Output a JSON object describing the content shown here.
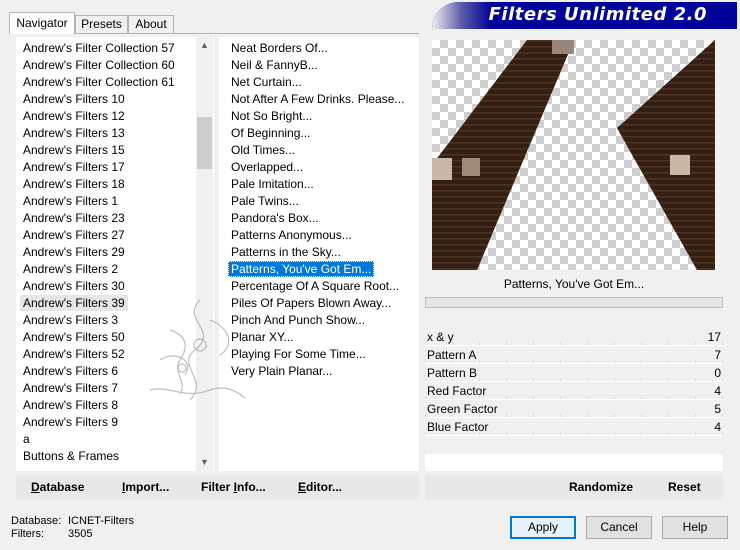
{
  "tabs": [
    {
      "label": "Navigator",
      "active": true
    },
    {
      "label": "Presets",
      "active": false
    },
    {
      "label": "About",
      "active": false
    }
  ],
  "banner": {
    "title": "Filters Unlimited 2.0"
  },
  "categories": [
    "Andrew's Filter Collection 57",
    "Andrew's Filter Collection 60",
    "Andrew's Filter Collection 61",
    "Andrew's Filters 10",
    "Andrew's Filters 12",
    "Andrew's Filters 13",
    "Andrew's Filters 15",
    "Andrew's Filters 17",
    "Andrew's Filters 18",
    "Andrew's Filters 1",
    "Andrew's Filters 23",
    "Andrew's Filters 27",
    "Andrew's Filters 29",
    "Andrew's Filters 2",
    "Andrew's Filters 30",
    "Andrew's Filters 39",
    "Andrew's Filters 3",
    "Andrew's Filters 50",
    "Andrew's Filters 52",
    "Andrew's Filters 6",
    "Andrew's Filters 7",
    "Andrew's Filters 8",
    "Andrew's Filters 9",
    "a",
    "Buttons & Frames"
  ],
  "selected_category": "Andrew's Filters 39",
  "filters": [
    "Neat Borders Of...",
    "Neil & FannyB...",
    "Net Curtain...",
    "Not After A Few Drinks. Please...",
    "Not So Bright...",
    "Of Beginning...",
    "Old Times...",
    "Overlapped...",
    "Pale Imitation...",
    "Pale Twins...",
    "Pandora's Box...",
    "Patterns Anonymous...",
    "Patterns in the Sky...",
    "Patterns, You've Got Em...",
    "Percentage Of A Square Root...",
    "Piles Of Papers Blown Away...",
    "Pinch And Punch Show...",
    "Planar XY...",
    "Playing For Some Time...",
    "Very Plain Planar..."
  ],
  "selected_filter": "Patterns, You've Got Em...",
  "preview": {
    "filter_name": "Patterns, You've Got Em..."
  },
  "parameters": [
    {
      "name": "x & y",
      "value": "17"
    },
    {
      "name": "Pattern A",
      "value": "7"
    },
    {
      "name": "Pattern B",
      "value": "0"
    },
    {
      "name": "Red Factor",
      "value": "4"
    },
    {
      "name": "Green Factor",
      "value": "5"
    },
    {
      "name": "Blue Factor",
      "value": "4"
    }
  ],
  "toolbar": {
    "database": {
      "pre": "",
      "ul": "D",
      "post": "atabase"
    },
    "import": {
      "pre": "",
      "ul": "I",
      "post": "mport..."
    },
    "filter_info": {
      "pre": "Filter ",
      "ul": "I",
      "post": "nfo..."
    },
    "editor": {
      "pre": "",
      "ul": "E",
      "post": "ditor..."
    },
    "randomize": "Randomize",
    "reset": "Reset"
  },
  "status": {
    "database_label": "Database:",
    "database_value": "ICNET-Filters",
    "filters_label": "Filters:",
    "filters_value": "3505"
  },
  "buttons": {
    "apply": "Apply",
    "cancel": "Cancel",
    "help": "Help"
  },
  "colors": {
    "selection": "#0078d7",
    "banner": "#00009a"
  }
}
